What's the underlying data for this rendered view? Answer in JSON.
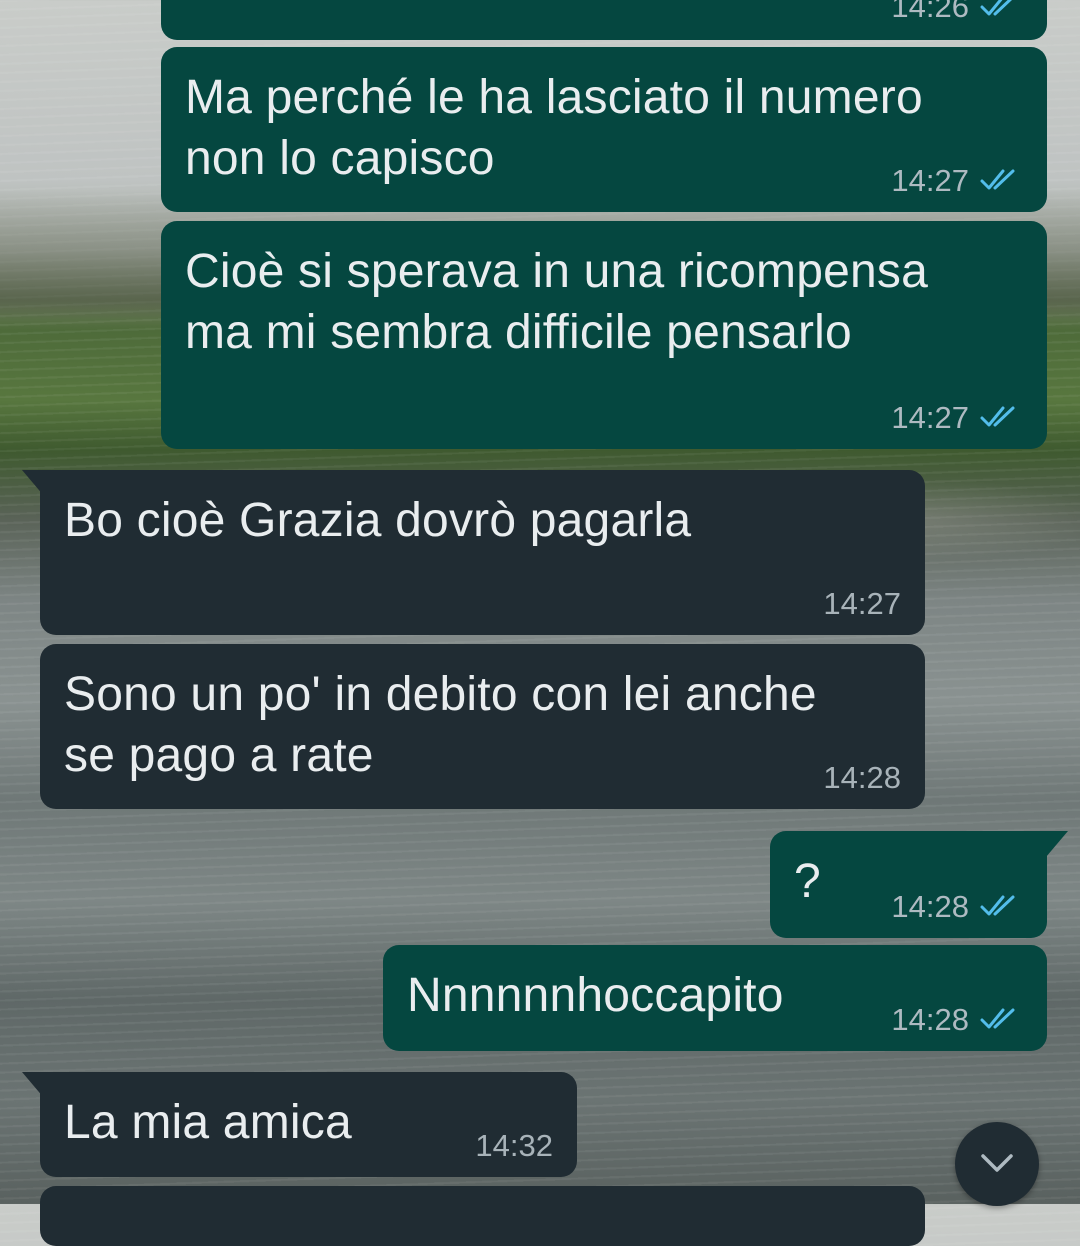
{
  "messages": [
    {
      "direction": "outgoing",
      "text": "",
      "time": "14:26",
      "read": true
    },
    {
      "direction": "outgoing",
      "text": "Ma perché le ha lasciato il numero\nnon lo capisco",
      "time": "14:27",
      "read": true
    },
    {
      "direction": "outgoing",
      "text": "Cioè si sperava in una ricompensa\nma mi sembra difficile pensarlo",
      "time": "14:27",
      "read": true
    },
    {
      "direction": "incoming",
      "text": "Bo cioè Grazia dovrò pagarla",
      "time": "14:27"
    },
    {
      "direction": "incoming",
      "text": "Sono un po' in debito con lei anche\nse pago a rate",
      "time": "14:28"
    },
    {
      "direction": "outgoing",
      "text": "?",
      "time": "14:28",
      "read": true
    },
    {
      "direction": "outgoing",
      "text": "Nnnnnnhoccapito",
      "time": "14:28",
      "read": true
    },
    {
      "direction": "incoming",
      "text": "La mia amica",
      "time": "14:32"
    }
  ],
  "icons": {
    "read_receipt": "double-check-icon",
    "scroll_down": "chevron-down-icon"
  },
  "colors": {
    "outgoing_bubble": "#054740",
    "incoming_bubble": "#202c33",
    "read_tick": "#53bdeb",
    "text": "#e9edef",
    "timestamp": "#aebac1"
  }
}
